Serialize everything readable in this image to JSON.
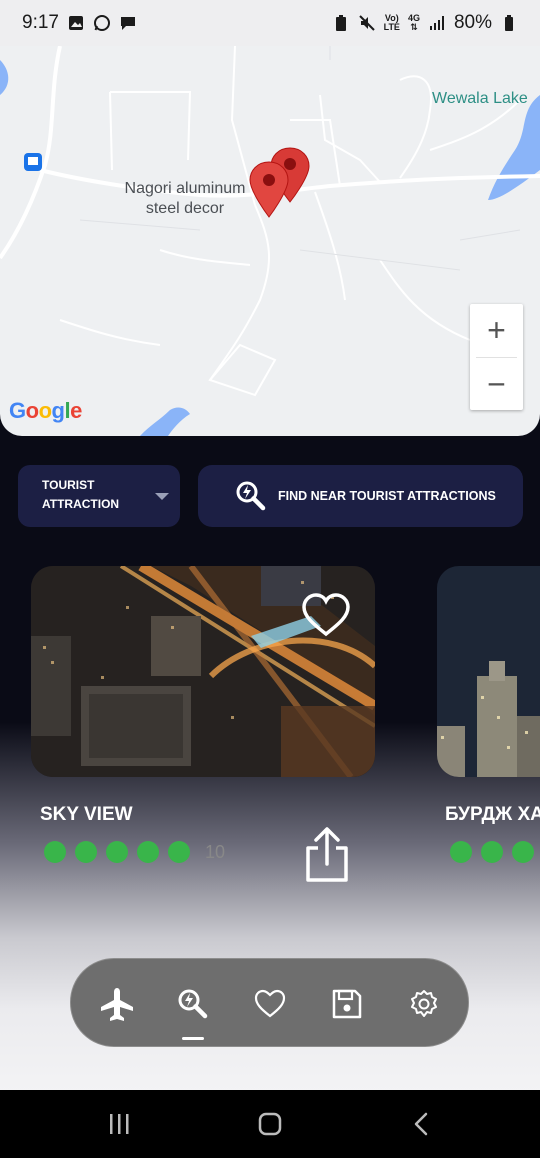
{
  "status_bar": {
    "time": "9:17",
    "battery": "80%",
    "network_top": "4G",
    "volte_top": "Vo)",
    "volte_bottom": "LTE"
  },
  "map": {
    "place_label_line1": "Nagori aluminum",
    "place_label_line2": "steel decor",
    "lake_label": "Wewala Lake",
    "zoom_in_label": "+",
    "zoom_out_label": "−",
    "logo_letters": [
      "G",
      "o",
      "o",
      "g",
      "l",
      "e"
    ],
    "logo_colors": [
      "#4285F4",
      "#EA4335",
      "#FBBC05",
      "#4285F4",
      "#34A853",
      "#EA4335"
    ]
  },
  "filter": {
    "dropdown_line1": "TOURIST",
    "dropdown_line2": "ATTRACTION",
    "find_button_label": "FIND NEAR TOURIST ATTRACTIONS"
  },
  "cards": [
    {
      "title": "SKY VIEW",
      "rating_dots": 5,
      "rating_count": "10"
    },
    {
      "title": "БУРДЖ ХА",
      "rating_dots": 3
    }
  ],
  "bottom_nav": {
    "items": [
      "airplane-icon",
      "search-attraction-icon",
      "heart-icon",
      "save-icon",
      "gear-icon"
    ],
    "active": "search-attraction-icon"
  },
  "colors": {
    "accent_panel": "#1c1f44",
    "rating_green": "#39b54a",
    "pin_red": "#d83a36"
  }
}
